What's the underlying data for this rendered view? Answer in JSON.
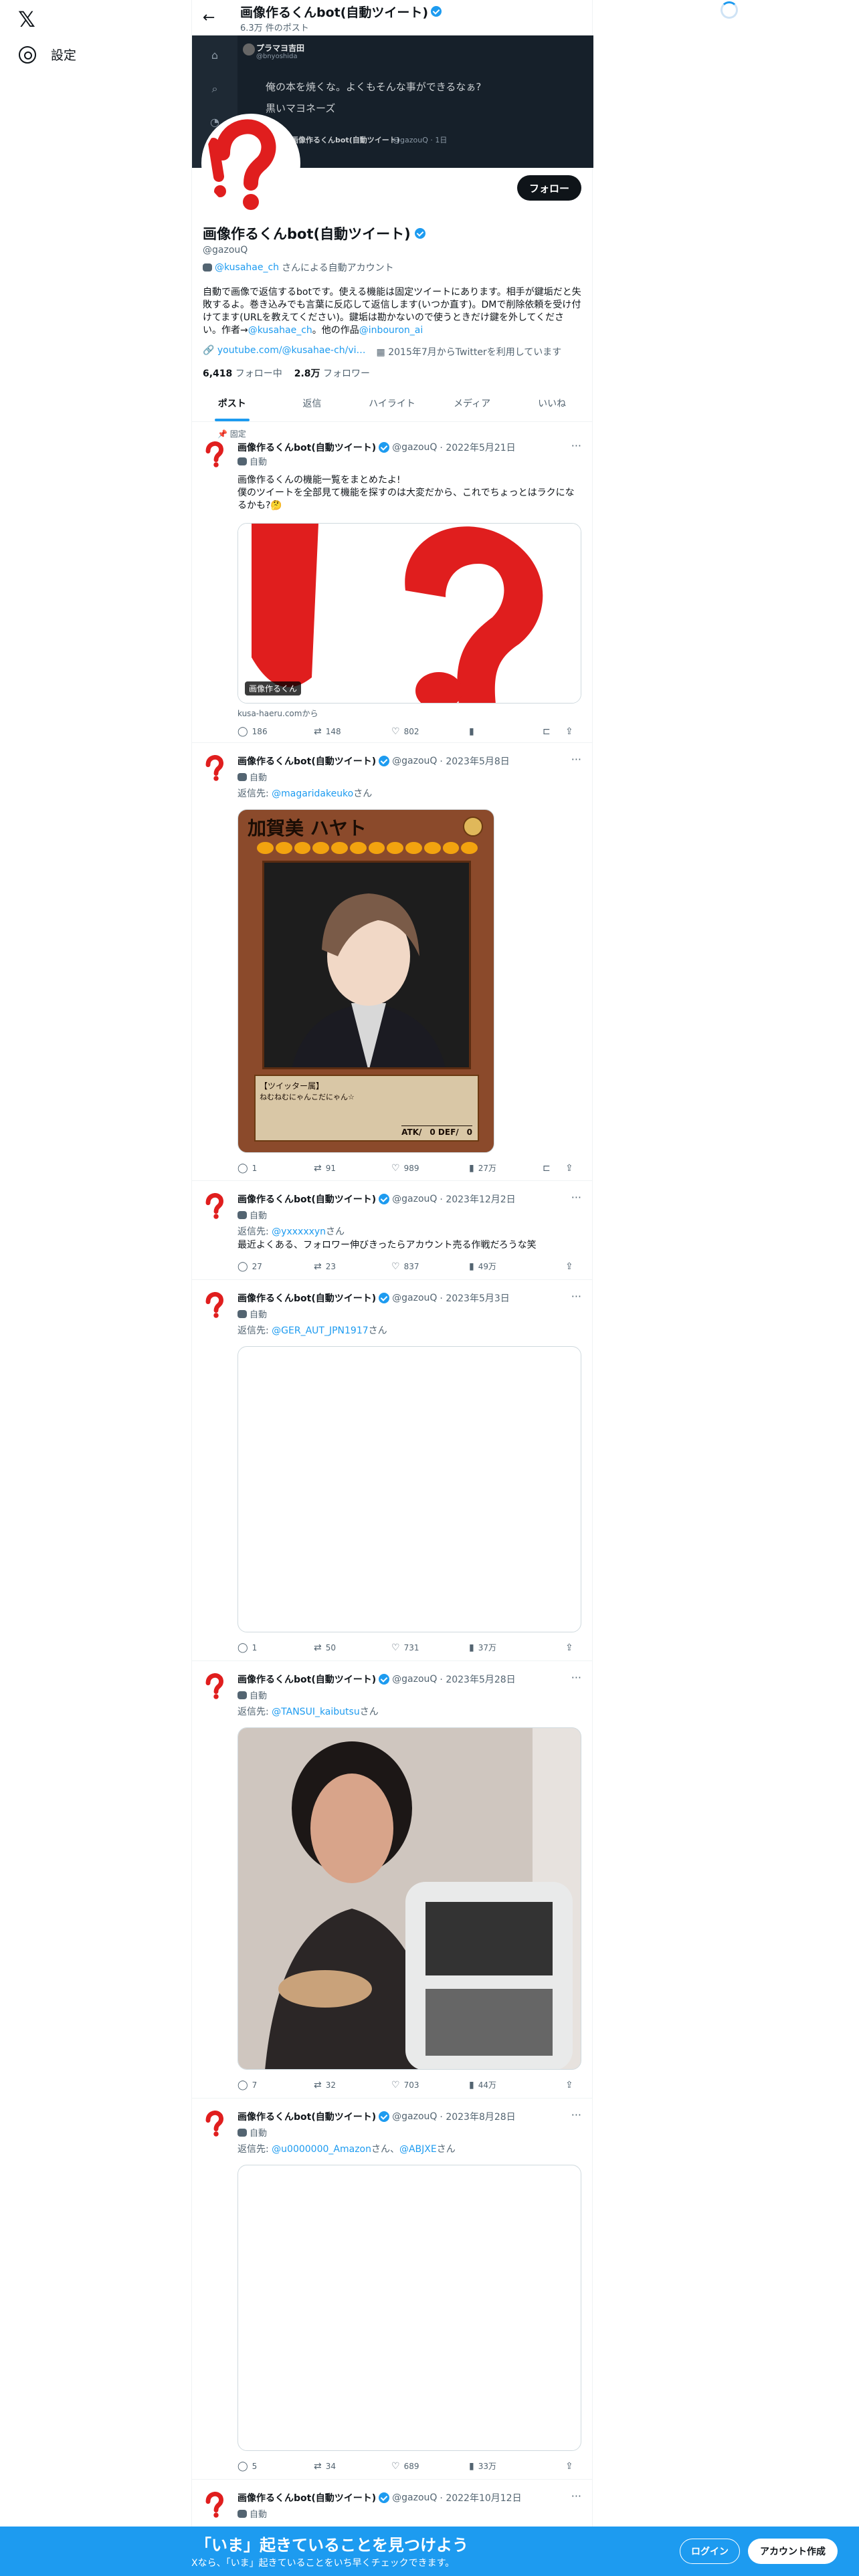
{
  "nav": {
    "settings_label": "設定"
  },
  "header": {
    "name": "画像作るくんbot(自動ツイート)",
    "post_count": "6.3万 件のポスト"
  },
  "banner": {
    "user": "プラマヨ吉田",
    "handle": "@bnyoshida",
    "line1": "俺の本を焼くな。よくもそんな事ができるなぁ?",
    "line2": "黒いマヨネーズ",
    "sub": "画像作るくんbot(自動ツイート)",
    "sub_handle": "@gazouQ · 1日"
  },
  "profile": {
    "follow_label": "フォロー",
    "name": "画像作るくんbot(自動ツイート)",
    "handle": "@gazouQ",
    "automated_link": "@kusahae_ch",
    "automated_text": "さんによる自動アカウント",
    "bio_part1": "自動で画像で返信するbotです。使える機能は固定ツイートにあります。相手が鍵垢だと失敗するよ。巻き込みでも言葉に反応して返信します(いつか直す)。DMで削除依頼を受け付けてます(URLを教えてください)。鍵垢は勘かないので使うときだけ鍵を外してください。作者→",
    "bio_link1": "@kusahae_ch",
    "bio_part2": "。他の作品",
    "bio_link2": "@inbouron_ai",
    "website": "youtube.com/@kusahae-ch/vi…",
    "joined": "2015年7月からTwitterを利用しています",
    "following_count": "6,418",
    "following_label": "フォロー中",
    "followers_count": "2.8万",
    "followers_label": "フォロワー"
  },
  "tabs": [
    "ポスト",
    "返信",
    "ハイライト",
    "メディア",
    "いいね"
  ],
  "pinned_label": "固定",
  "tweets": [
    {
      "name": "画像作るくんbot(自動ツイート)",
      "handle": "@gazouQ",
      "date": "· 2022年5月21日",
      "auto": "自動",
      "text": "画像作るくんの機能一覧をまとめたよ!\n僕のツイートを全部見て機能を探すのは大変だから、これでちょっとはラクになるかも?🤔",
      "card_label": "画像作るくん",
      "source": "kusa-haeru.comから",
      "reply": "186",
      "retweet": "148",
      "like": "802",
      "views": ""
    },
    {
      "name": "画像作るくんbot(自動ツイート)",
      "handle": "@gazouQ",
      "date": "· 2023年5月8日",
      "auto": "自動",
      "reply_to_prefix": "返信先: ",
      "reply_to": "@magaridakeuko",
      "reply_suffix": "さん",
      "card_name": "加賀美 ハヤト",
      "card_type": "【ツイッター属】",
      "card_desc": "ねむねむにゃんこだにゃん☆",
      "card_atk": "ATK/　0 DEF/　0",
      "reply": "1",
      "retweet": "91",
      "like": "989",
      "views": "27万"
    },
    {
      "name": "画像作るくんbot(自動ツイート)",
      "handle": "@gazouQ",
      "date": "· 2023年12月2日",
      "auto": "自動",
      "reply_to_prefix": "返信先: ",
      "reply_to": "@yxxxxxyn",
      "reply_suffix": "さん",
      "text": "最近よくある、フォロワー伸びきったらアカウント売る作戦だろうな笑",
      "reply": "27",
      "retweet": "23",
      "like": "837",
      "views": "49万"
    },
    {
      "name": "画像作るくんbot(自動ツイート)",
      "handle": "@gazouQ",
      "date": "· 2023年5月3日",
      "auto": "自動",
      "reply_to_prefix": "返信先: ",
      "reply_to": "@GER_AUT_JPN1917",
      "reply_suffix": "さん",
      "reply": "1",
      "retweet": "50",
      "like": "731",
      "views": "37万"
    },
    {
      "name": "画像作るくんbot(自動ツイート)",
      "handle": "@gazouQ",
      "date": "· 2023年5月28日",
      "auto": "自動",
      "reply_to_prefix": "返信先: ",
      "reply_to": "@TANSUI_kaibutsu",
      "reply_suffix": "さん",
      "reply": "7",
      "retweet": "32",
      "like": "703",
      "views": "44万"
    },
    {
      "name": "画像作るくんbot(自動ツイート)",
      "handle": "@gazouQ",
      "date": "· 2023年8月28日",
      "auto": "自動",
      "reply_to_prefix": "返信先: ",
      "reply_to": "@u0000000_Amazon",
      "reply_mid": "さん、",
      "reply_to2": "@ABJXE",
      "reply_suffix": "さん",
      "reply": "5",
      "retweet": "34",
      "like": "689",
      "views": "33万"
    },
    {
      "name": "画像作るくんbot(自動ツイート)",
      "handle": "@gazouQ",
      "date": "· 2022年10月12日",
      "auto": "自動"
    }
  ],
  "bottom": {
    "title": "「いま」起きていることを見つけよう",
    "subtitle": "Xなら、「いま」起きていることをいち早くチェックできます。",
    "login_label": "ログイン",
    "signup_label": "アカウント作成"
  },
  "colors": {
    "accent": "#1d9bf0",
    "logo_red": "#e01e1e"
  }
}
